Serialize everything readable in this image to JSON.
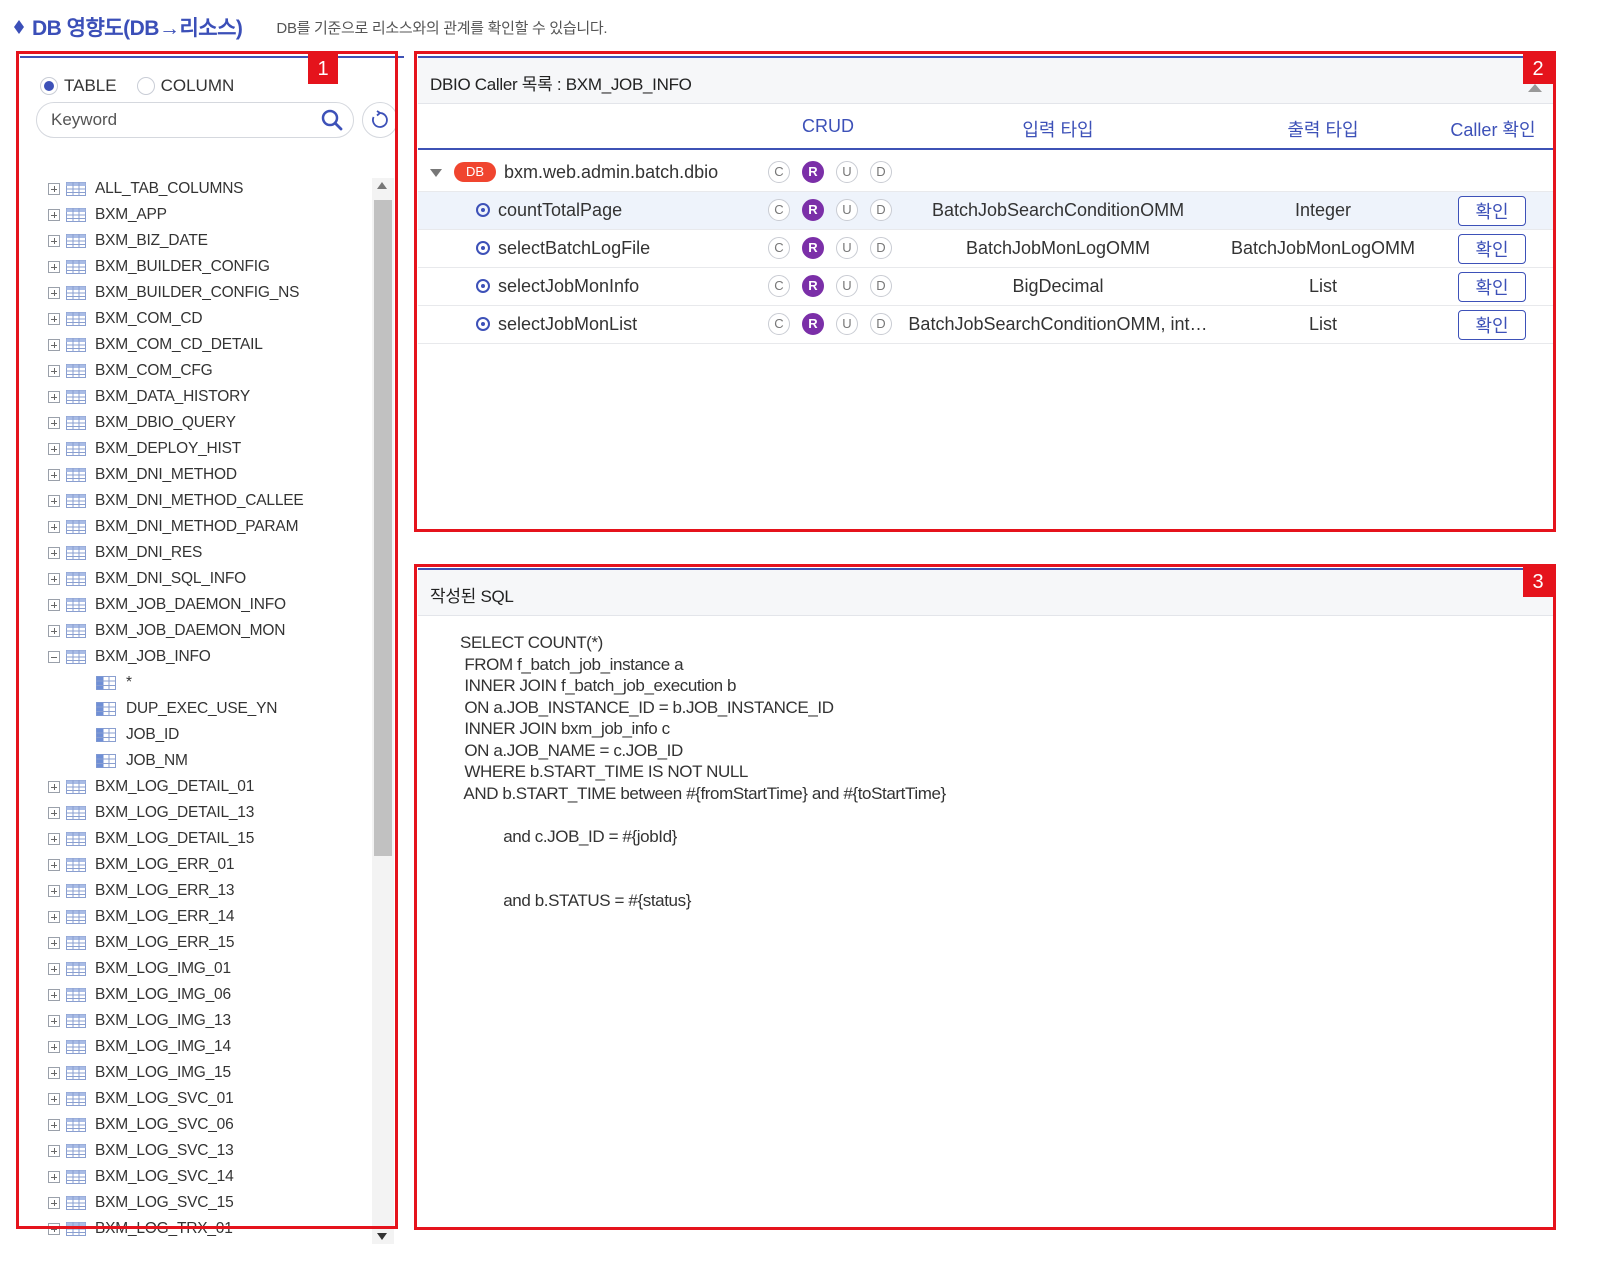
{
  "header": {
    "title": "DB 영향도(DB→리소스)",
    "description": "DB를 기준으로 리소스와의 관계를 확인할 수 있습니다."
  },
  "annotations": [
    "1",
    "2",
    "3"
  ],
  "left_panel": {
    "radio_options": [
      {
        "label": "TABLE",
        "checked": true
      },
      {
        "label": "COLUMN",
        "checked": false
      }
    ],
    "search": {
      "placeholder": "Keyword",
      "value": ""
    },
    "tree": [
      {
        "label": "ALL_TAB_COLUMNS",
        "type": "table",
        "expanded": false
      },
      {
        "label": "BXM_APP",
        "type": "table",
        "expanded": false
      },
      {
        "label": "BXM_BIZ_DATE",
        "type": "table",
        "expanded": false
      },
      {
        "label": "BXM_BUILDER_CONFIG",
        "type": "table",
        "expanded": false
      },
      {
        "label": "BXM_BUILDER_CONFIG_NS",
        "type": "table",
        "expanded": false
      },
      {
        "label": "BXM_COM_CD",
        "type": "table",
        "expanded": false
      },
      {
        "label": "BXM_COM_CD_DETAIL",
        "type": "table",
        "expanded": false
      },
      {
        "label": "BXM_COM_CFG",
        "type": "table",
        "expanded": false
      },
      {
        "label": "BXM_DATA_HISTORY",
        "type": "table",
        "expanded": false
      },
      {
        "label": "BXM_DBIO_QUERY",
        "type": "table",
        "expanded": false
      },
      {
        "label": "BXM_DEPLOY_HIST",
        "type": "table",
        "expanded": false
      },
      {
        "label": "BXM_DNI_METHOD",
        "type": "table",
        "expanded": false
      },
      {
        "label": "BXM_DNI_METHOD_CALLEE",
        "type": "table",
        "expanded": false
      },
      {
        "label": "BXM_DNI_METHOD_PARAM",
        "type": "table",
        "expanded": false
      },
      {
        "label": "BXM_DNI_RES",
        "type": "table",
        "expanded": false
      },
      {
        "label": "BXM_DNI_SQL_INFO",
        "type": "table",
        "expanded": false
      },
      {
        "label": "BXM_JOB_DAEMON_INFO",
        "type": "table",
        "expanded": false
      },
      {
        "label": "BXM_JOB_DAEMON_MON",
        "type": "table",
        "expanded": false
      },
      {
        "label": "BXM_JOB_INFO",
        "type": "table",
        "expanded": true
      },
      {
        "label": "*",
        "type": "column"
      },
      {
        "label": "DUP_EXEC_USE_YN",
        "type": "column"
      },
      {
        "label": "JOB_ID",
        "type": "column"
      },
      {
        "label": "JOB_NM",
        "type": "column"
      },
      {
        "label": "BXM_LOG_DETAIL_01",
        "type": "table",
        "expanded": false
      },
      {
        "label": "BXM_LOG_DETAIL_13",
        "type": "table",
        "expanded": false
      },
      {
        "label": "BXM_LOG_DETAIL_15",
        "type": "table",
        "expanded": false
      },
      {
        "label": "BXM_LOG_ERR_01",
        "type": "table",
        "expanded": false
      },
      {
        "label": "BXM_LOG_ERR_13",
        "type": "table",
        "expanded": false
      },
      {
        "label": "BXM_LOG_ERR_14",
        "type": "table",
        "expanded": false
      },
      {
        "label": "BXM_LOG_ERR_15",
        "type": "table",
        "expanded": false
      },
      {
        "label": "BXM_LOG_IMG_01",
        "type": "table",
        "expanded": false
      },
      {
        "label": "BXM_LOG_IMG_06",
        "type": "table",
        "expanded": false
      },
      {
        "label": "BXM_LOG_IMG_13",
        "type": "table",
        "expanded": false
      },
      {
        "label": "BXM_LOG_IMG_14",
        "type": "table",
        "expanded": false
      },
      {
        "label": "BXM_LOG_IMG_15",
        "type": "table",
        "expanded": false
      },
      {
        "label": "BXM_LOG_SVC_01",
        "type": "table",
        "expanded": false
      },
      {
        "label": "BXM_LOG_SVC_06",
        "type": "table",
        "expanded": false
      },
      {
        "label": "BXM_LOG_SVC_13",
        "type": "table",
        "expanded": false
      },
      {
        "label": "BXM_LOG_SVC_14",
        "type": "table",
        "expanded": false
      },
      {
        "label": "BXM_LOG_SVC_15",
        "type": "table",
        "expanded": false
      },
      {
        "label": "BXM_LOG_TRX_01",
        "type": "table",
        "expanded": false
      }
    ]
  },
  "caller_panel": {
    "title": "DBIO Caller 목록 : BXM_JOB_INFO",
    "columns": [
      "CRUD",
      "입력 타입",
      "출력 타입",
      "Caller 확인"
    ],
    "group": {
      "badge": "DB",
      "name": "bxm.web.admin.batch.dbio",
      "crud": [
        "C",
        "R",
        "U",
        "D"
      ],
      "active": [
        "R"
      ]
    },
    "rows": [
      {
        "name": "countTotalPage",
        "crud": [
          "C",
          "R",
          "U",
          "D"
        ],
        "active": [
          "R"
        ],
        "input": "BatchJobSearchConditionOMM",
        "output": "Integer",
        "button": "확인",
        "selected": true
      },
      {
        "name": "selectBatchLogFile",
        "crud": [
          "C",
          "R",
          "U",
          "D"
        ],
        "active": [
          "R"
        ],
        "input": "BatchJobMonLogOMM",
        "output": "BatchJobMonLogOMM",
        "button": "확인",
        "selected": false
      },
      {
        "name": "selectJobMonInfo",
        "crud": [
          "C",
          "R",
          "U",
          "D"
        ],
        "active": [
          "R"
        ],
        "input": "BigDecimal",
        "output": "List",
        "button": "확인",
        "selected": false
      },
      {
        "name": "selectJobMonList",
        "crud": [
          "C",
          "R",
          "U",
          "D"
        ],
        "active": [
          "R"
        ],
        "input": "BatchJobSearchConditionOMM, int…",
        "output": "List",
        "button": "확인",
        "selected": false
      }
    ]
  },
  "sql_panel": {
    "title": "작성된 SQL",
    "sql": "SELECT COUNT(*)\n FROM f_batch_job_instance a\n INNER JOIN f_batch_job_execution b\n ON a.JOB_INSTANCE_ID = b.JOB_INSTANCE_ID\n INNER JOIN bxm_job_info c\n ON a.JOB_NAME = c.JOB_ID\n WHERE b.START_TIME IS NOT NULL\n AND b.START_TIME between #{fromStartTime} and #{toStartTime}\n\n          and c.JOB_ID = #{jobId}\n\n\n          and b.STATUS = #{status}"
  },
  "colors": {
    "accent": "#3d51b8",
    "annotation_red": "#e5131c",
    "read_active": "#7b2fa8",
    "db_badge": "#f0452f"
  }
}
